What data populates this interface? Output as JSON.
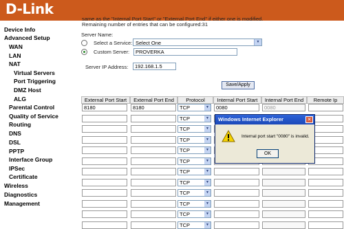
{
  "header": {
    "logo": "D-Link"
  },
  "sidebar": {
    "items": [
      {
        "label": "Device Info"
      },
      {
        "label": "Advanced Setup"
      },
      {
        "label": "WAN"
      },
      {
        "label": "LAN"
      },
      {
        "label": "NAT"
      },
      {
        "label": "Virtual Servers"
      },
      {
        "label": "Port Triggering"
      },
      {
        "label": "DMZ Host"
      },
      {
        "label": "ALG"
      },
      {
        "label": "Parental Control"
      },
      {
        "label": "Quality of Service"
      },
      {
        "label": "Routing"
      },
      {
        "label": "DNS"
      },
      {
        "label": "DSL"
      },
      {
        "label": "PPTP"
      },
      {
        "label": "Interface Group"
      },
      {
        "label": "IPSec"
      },
      {
        "label": "Certificate"
      },
      {
        "label": "Wireless"
      },
      {
        "label": "Diagnostics"
      },
      {
        "label": "Management"
      }
    ]
  },
  "main": {
    "note_line1": "same as the \"Internal Port Start\" or \"External Port End\" if either one is modified.",
    "note_line2": "Remaining number of entries that can be configured:31",
    "server_name_label": "Server Name:",
    "select_service_label": "Select a Service:",
    "select_service_value": "Select One",
    "custom_server_label": "Custom Server:",
    "custom_server_value": "PROVERKA",
    "server_ip_label": "Server IP Address:",
    "server_ip_value": "192.168.1.5",
    "save_apply_label": "Save/Apply",
    "table": {
      "headers": [
        "External Port Start",
        "External Port End",
        "Protocol",
        "Internal Port Start",
        "Internal Port End",
        "Remote Ip"
      ],
      "rows": [
        {
          "ext_start": "8180",
          "ext_end": "8180",
          "protocol": "TCP",
          "int_start": "0080",
          "int_end": "0080"
        },
        {
          "ext_start": "",
          "ext_end": "",
          "protocol": "TCP",
          "int_start": "",
          "int_end": ""
        },
        {
          "ext_start": "",
          "ext_end": "",
          "protocol": "TCP",
          "int_start": "",
          "int_end": ""
        },
        {
          "ext_start": "",
          "ext_end": "",
          "protocol": "TCP",
          "int_start": "",
          "int_end": ""
        },
        {
          "ext_start": "",
          "ext_end": "",
          "protocol": "TCP",
          "int_start": "",
          "int_end": ""
        },
        {
          "ext_start": "",
          "ext_end": "",
          "protocol": "TCP",
          "int_start": "",
          "int_end": ""
        },
        {
          "ext_start": "",
          "ext_end": "",
          "protocol": "TCP",
          "int_start": "",
          "int_end": ""
        },
        {
          "ext_start": "",
          "ext_end": "",
          "protocol": "TCP",
          "int_start": "",
          "int_end": ""
        },
        {
          "ext_start": "",
          "ext_end": "",
          "protocol": "TCP",
          "int_start": "",
          "int_end": ""
        },
        {
          "ext_start": "",
          "ext_end": "",
          "protocol": "TCP",
          "int_start": "",
          "int_end": ""
        },
        {
          "ext_start": "",
          "ext_end": "",
          "protocol": "TCP",
          "int_start": "",
          "int_end": ""
        },
        {
          "ext_start": "",
          "ext_end": "",
          "protocol": "TCP",
          "int_start": "",
          "int_end": ""
        }
      ]
    }
  },
  "dialog": {
    "title": "Windows Internet Explorer",
    "message": "Internal port start \"0080\" is invalid.",
    "ok_label": "OK"
  },
  "colors": {
    "header_bg": "#cc5a1c",
    "accent": "#1b48b8"
  }
}
